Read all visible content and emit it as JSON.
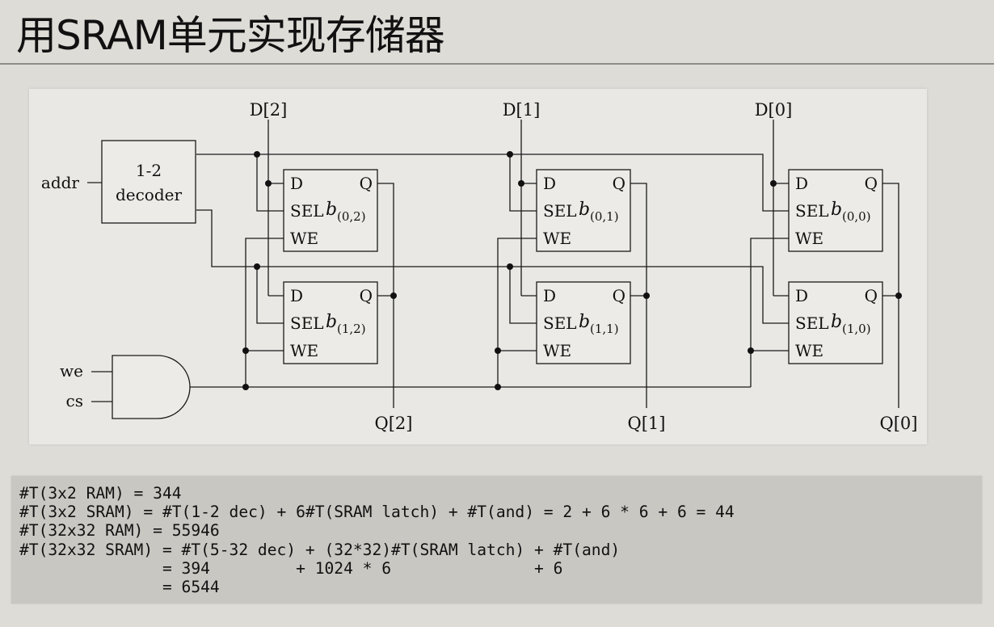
{
  "title": "用SRAM单元实现存储器",
  "diagram": {
    "data_inputs": [
      "D[2]",
      "D[1]",
      "D[0]"
    ],
    "outputs": [
      "Q[2]",
      "Q[1]",
      "Q[0]"
    ],
    "addr_label": "addr",
    "we_label": "we",
    "cs_label": "cs",
    "decoder_line1": "1-2",
    "decoder_line2": "decoder",
    "cell_pins": {
      "d": "D",
      "q": "Q",
      "sel": "SEL",
      "we": "WE"
    },
    "cell_symbol": "b",
    "cells": [
      {
        "row": 0,
        "col": 0,
        "subscript": "(0,2)"
      },
      {
        "row": 0,
        "col": 1,
        "subscript": "(0,1)"
      },
      {
        "row": 0,
        "col": 2,
        "subscript": "(0,0)"
      },
      {
        "row": 1,
        "col": 0,
        "subscript": "(1,2)"
      },
      {
        "row": 1,
        "col": 1,
        "subscript": "(1,1)"
      },
      {
        "row": 1,
        "col": 2,
        "subscript": "(1,0)"
      }
    ]
  },
  "formulas": [
    "#T(3x2 RAM) = 344",
    "#T(3x2 SRAM) = #T(1-2 dec) + 6#T(SRAM latch) + #T(and) = 2 + 6 * 6 + 6 = 44",
    "#T(32x32 RAM) = 55946",
    "#T(32x32 SRAM) = #T(5-32 dec) + (32*32)#T(SRAM latch) + #T(and)",
    "               = 394         + 1024 * 6               + 6",
    "               = 6544"
  ]
}
